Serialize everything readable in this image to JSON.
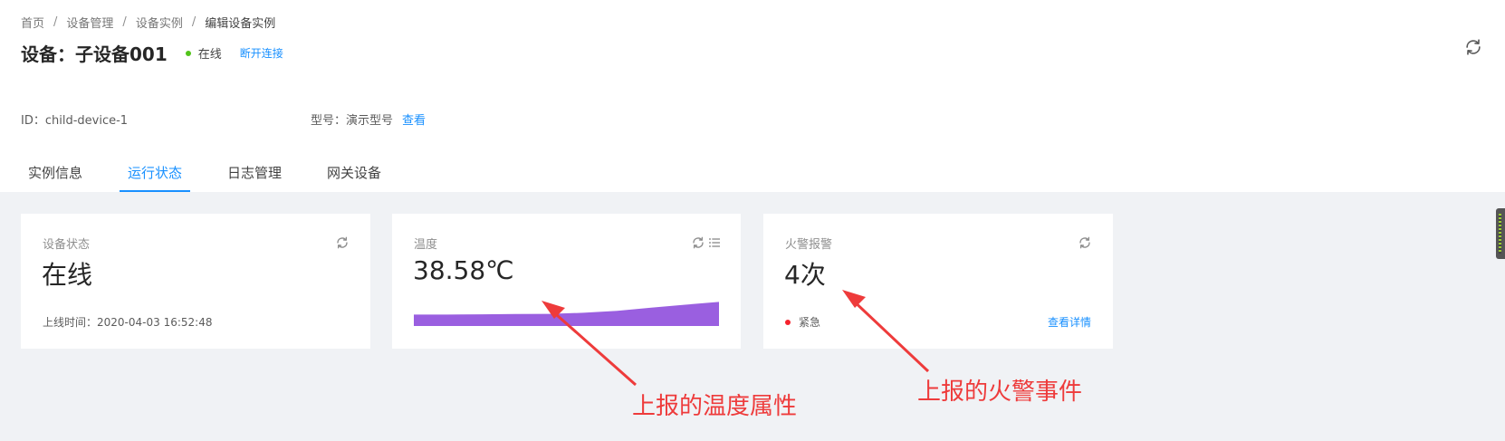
{
  "breadcrumb": {
    "items": [
      "首页",
      "设备管理",
      "设备实例",
      "编辑设备实例"
    ],
    "separator": "/"
  },
  "header": {
    "title": "设备：子设备001",
    "status": "在线",
    "status_color": "#52c41a",
    "disconnect_label": "断开连接"
  },
  "info": {
    "id_label": "ID：",
    "id_value": "child-device-1",
    "model_label": "型号：",
    "model_value": "演示型号",
    "view_label": "查看"
  },
  "tabs": [
    {
      "label": "实例信息",
      "active": false
    },
    {
      "label": "运行状态",
      "active": true
    },
    {
      "label": "日志管理",
      "active": false
    },
    {
      "label": "网关设备",
      "active": false
    }
  ],
  "cards": {
    "device_status": {
      "label": "设备状态",
      "value": "在线",
      "online_time_label": "上线时间：",
      "online_time": "2020-04-03 16:52:48",
      "icon": "refresh-icon"
    },
    "temperature": {
      "label": "温度",
      "value": "38.58℃",
      "icons": [
        "refresh-icon",
        "list-icon"
      ],
      "chart_color": "#9a5fe0",
      "trend": [
        0.45,
        0.45,
        0.46,
        0.47,
        0.48,
        0.52,
        0.6,
        0.72,
        0.84,
        0.95
      ]
    },
    "fire_alarm": {
      "label": "火警报警",
      "value": "4次",
      "level": "紧急",
      "level_color": "#f5222d",
      "details_label": "查看详情",
      "icon": "refresh-icon"
    }
  },
  "annotations": {
    "temperature_note": "上报的温度属性",
    "fire_note": "上报的火警事件",
    "color": "#ee3b3b"
  },
  "theme": {
    "accent": "#1890ff",
    "background": "#f0f2f5"
  }
}
